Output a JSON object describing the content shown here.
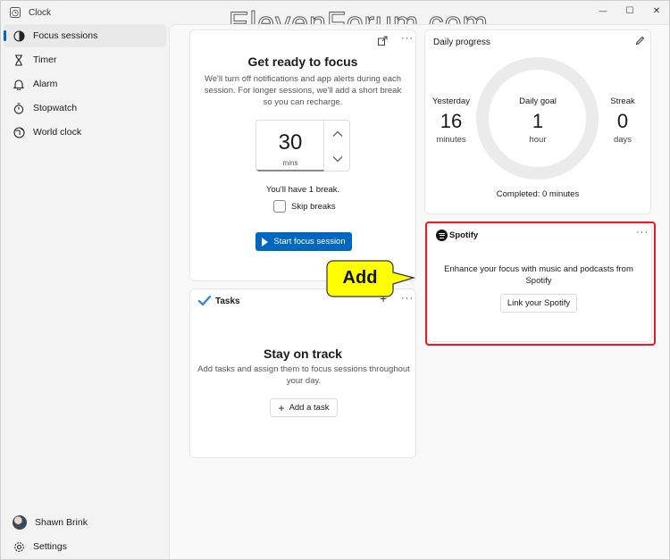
{
  "app": {
    "title": "Clock"
  },
  "watermark": "ElevenForum.com",
  "window_controls": {
    "minimize": "—",
    "maximize": "☐",
    "close": "✕"
  },
  "sidebar": {
    "items": [
      {
        "label": "Focus sessions",
        "icon": "focus-icon",
        "active": true
      },
      {
        "label": "Timer",
        "icon": "hourglass-icon"
      },
      {
        "label": "Alarm",
        "icon": "bell-icon"
      },
      {
        "label": "Stopwatch",
        "icon": "stopwatch-icon"
      },
      {
        "label": "World clock",
        "icon": "globe-icon"
      }
    ],
    "user": {
      "name": "Shawn Brink"
    },
    "settings_label": "Settings"
  },
  "focus": {
    "title": "Get ready to focus",
    "description": "We'll turn off notifications and app alerts during each session. For longer sessions, we'll add a short break so you can recharge.",
    "duration_value": "30",
    "duration_unit": "mins",
    "break_text": "You'll have 1 break.",
    "skip_breaks_label": "Skip breaks",
    "skip_breaks_checked": false,
    "start_label": "Start focus session",
    "more": "···"
  },
  "tasks": {
    "title": "Tasks",
    "add_icon": "+",
    "more": "···",
    "heading": "Stay on track",
    "description": "Add tasks and assign them to focus sessions throughout your day.",
    "add_task_label": "Add a task"
  },
  "daily_progress": {
    "title": "Daily progress",
    "yesterday": {
      "label": "Yesterday",
      "value": "16",
      "unit": "minutes"
    },
    "goal": {
      "label": "Daily goal",
      "value": "1",
      "unit": "hour"
    },
    "streak": {
      "label": "Streak",
      "value": "0",
      "unit": "days"
    },
    "completed_text": "Completed: 0 minutes",
    "progress_fraction": 0
  },
  "spotify": {
    "brand": "Spotify",
    "more": "···",
    "description": "Enhance your focus with music and podcasts from Spotify",
    "link_label": "Link your Spotify"
  },
  "callout": {
    "text": "Add"
  },
  "colors": {
    "accent": "#0067c0",
    "highlight": "#e8192c",
    "callout_fill": "#ffff00"
  }
}
